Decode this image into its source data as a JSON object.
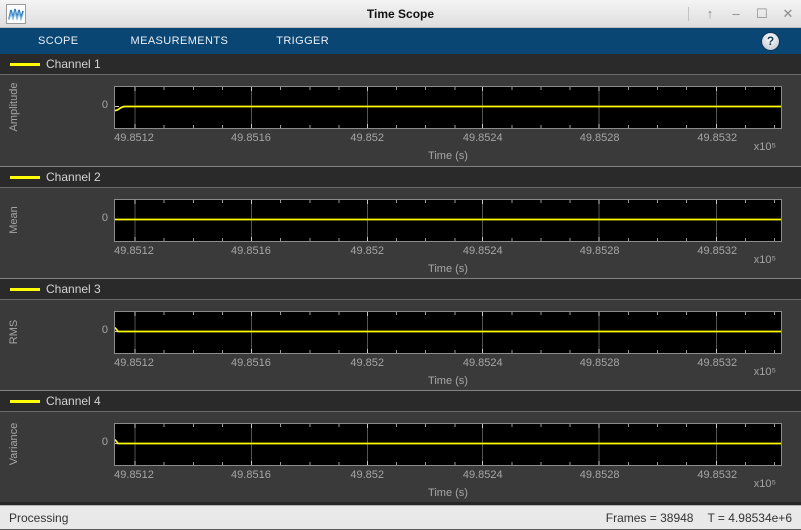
{
  "window": {
    "title": "Time Scope",
    "controls": [
      "↑",
      "–",
      "☐",
      "✕"
    ]
  },
  "toolbar": {
    "tabs": [
      "SCOPE",
      "MEASUREMENTS",
      "TRIGGER"
    ],
    "help_label": "?"
  },
  "axes": {
    "xticks": [
      "49.8512",
      "49.8516",
      "49.852",
      "49.8524",
      "49.8528",
      "49.8532"
    ],
    "xlabel": "Time (s)",
    "exponent": "x10⁵",
    "ytick": "0"
  },
  "channels": [
    {
      "legend": "Channel 1",
      "ylabel": "Amplitude"
    },
    {
      "legend": "Channel 2",
      "ylabel": "Mean"
    },
    {
      "legend": "Channel 3",
      "ylabel": "RMS"
    },
    {
      "legend": "Channel 4",
      "ylabel": "Variance"
    }
  ],
  "status": {
    "left": "Processing",
    "frames": "Frames = 38948",
    "time": "T = 4.98534e+6"
  },
  "colors": {
    "toolstrip_blue": "#0a4674",
    "trace_yellow": "#ffff00",
    "plot_background": "#000000",
    "panel_background": "#3a3a3a",
    "status_background": "#e9e9e9"
  },
  "chart_data": [
    {
      "type": "line",
      "title": "Channel 1",
      "ylabel": "Amplitude",
      "xlabel": "Time (s)",
      "x_multiplier": "x10^5",
      "x_ticks": [
        49.8512,
        49.8516,
        49.852,
        49.8524,
        49.8528,
        49.8532
      ],
      "x_range": [
        49.85105,
        49.85345
      ],
      "series": [
        {
          "name": "Channel 1",
          "constant_y": 0
        }
      ],
      "y_ticks": [
        0
      ],
      "grid": true,
      "legend_position": "top-left"
    },
    {
      "type": "line",
      "title": "Channel 2",
      "ylabel": "Mean",
      "xlabel": "Time (s)",
      "x_multiplier": "x10^5",
      "x_ticks": [
        49.8512,
        49.8516,
        49.852,
        49.8524,
        49.8528,
        49.8532
      ],
      "x_range": [
        49.85105,
        49.85345
      ],
      "series": [
        {
          "name": "Channel 2",
          "constant_y": 0
        }
      ],
      "y_ticks": [
        0
      ],
      "grid": true,
      "legend_position": "top-left"
    },
    {
      "type": "line",
      "title": "Channel 3",
      "ylabel": "RMS",
      "xlabel": "Time (s)",
      "x_multiplier": "x10^5",
      "x_ticks": [
        49.8512,
        49.8516,
        49.852,
        49.8524,
        49.8528,
        49.8532
      ],
      "x_range": [
        49.85105,
        49.85345
      ],
      "series": [
        {
          "name": "Channel 3",
          "constant_y": 0
        }
      ],
      "y_ticks": [
        0
      ],
      "grid": true,
      "legend_position": "top-left"
    },
    {
      "type": "line",
      "title": "Channel 4",
      "ylabel": "Variance",
      "xlabel": "Time (s)",
      "x_multiplier": "x10^5",
      "x_ticks": [
        49.8512,
        49.8516,
        49.852,
        49.8524,
        49.8528,
        49.8532
      ],
      "x_range": [
        49.85105,
        49.85345
      ],
      "series": [
        {
          "name": "Channel 4",
          "constant_y": 0
        }
      ],
      "y_ticks": [
        0
      ],
      "grid": true,
      "legend_position": "top-left"
    }
  ]
}
